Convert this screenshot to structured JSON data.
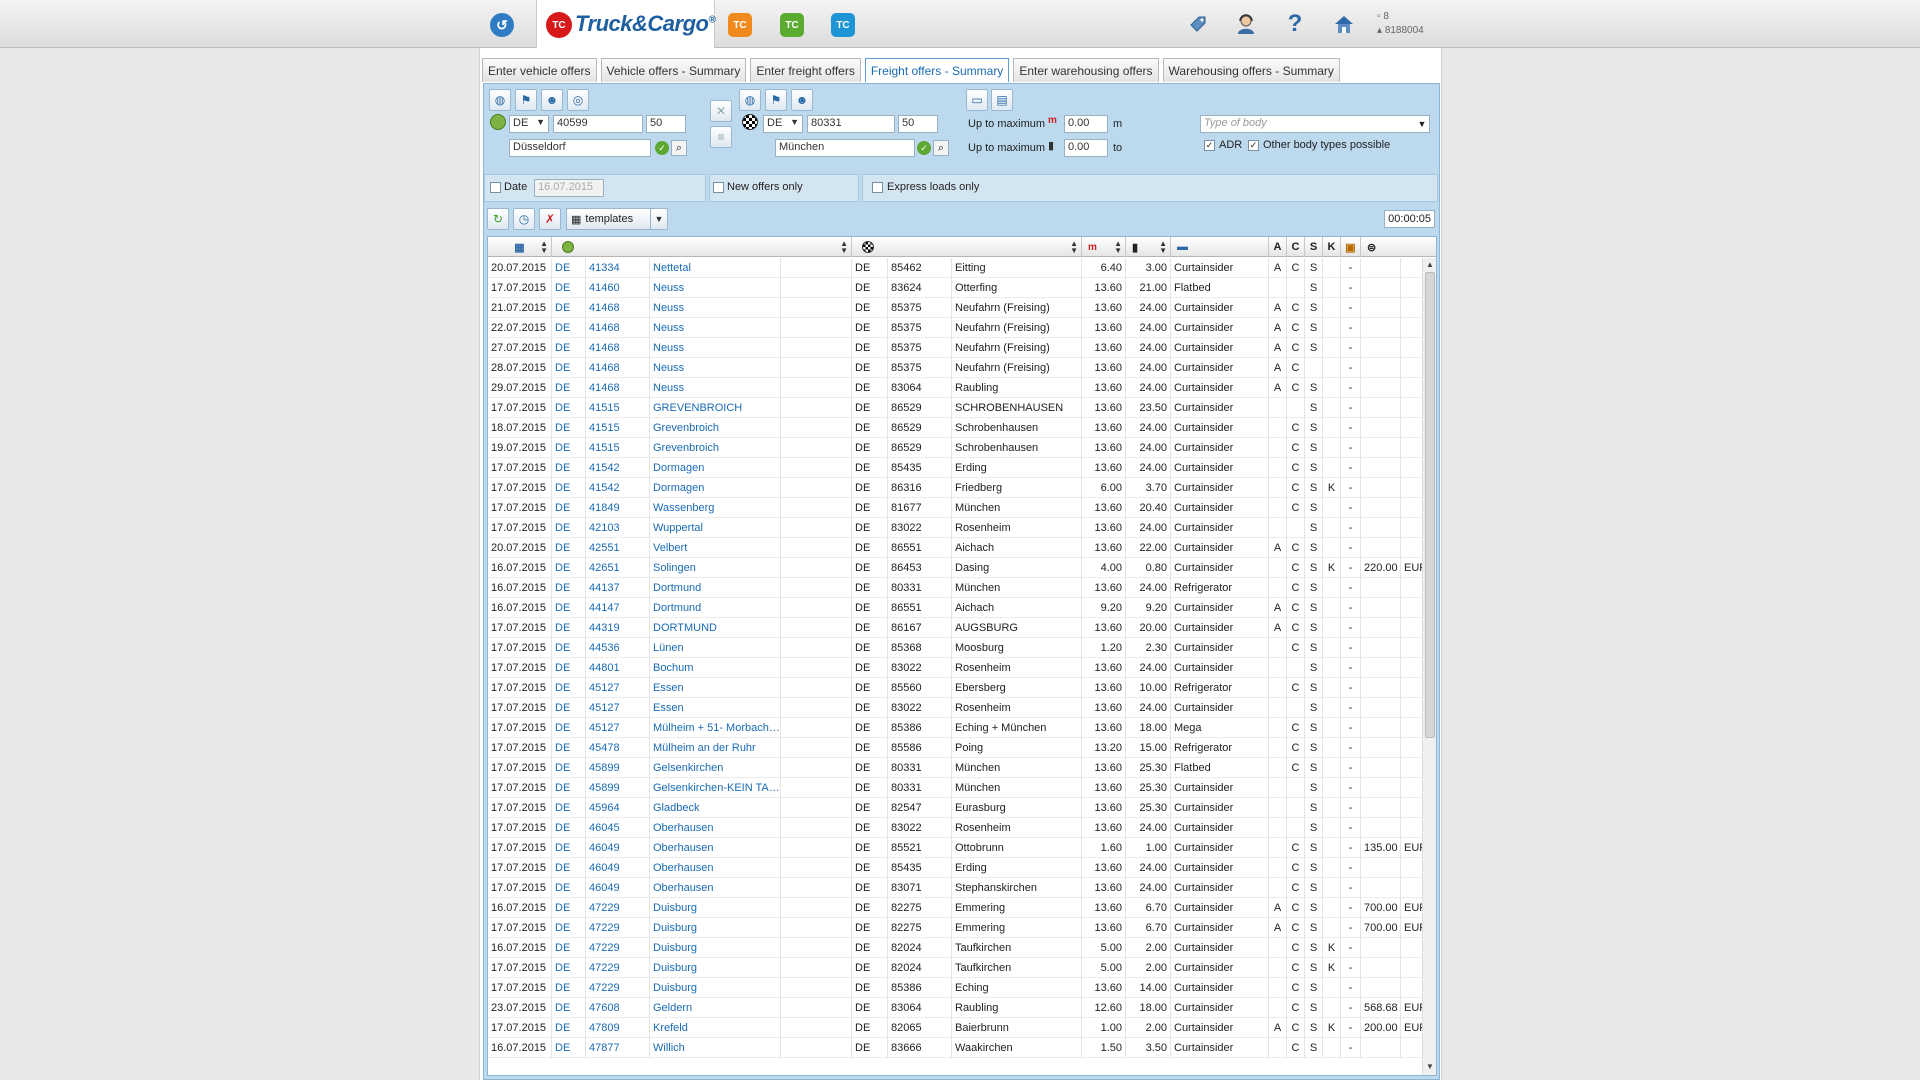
{
  "topbar": {
    "app_title_main": "Truck&Cargo",
    "app_title_reg": "®",
    "app_logo_text": "TC",
    "app_icons": [
      "TC",
      "TC",
      "TC"
    ],
    "user_count": "8",
    "user_id": "8188004",
    "icons": [
      "tag-icon",
      "support-agent-icon",
      "help-icon",
      "home-icon"
    ]
  },
  "tabs": [
    {
      "label": "Enter vehicle offers",
      "active": false
    },
    {
      "label": "Vehicle offers - Summary",
      "active": false
    },
    {
      "label": "Enter freight offers",
      "active": false
    },
    {
      "label": "Freight offers - Summary",
      "active": true
    },
    {
      "label": "Enter warehousing offers",
      "active": false
    },
    {
      "label": "Warehousing offers - Summary",
      "active": false
    }
  ],
  "search": {
    "origin": {
      "country": "DE",
      "zip": "40599",
      "radius": "50",
      "city": "Düsseldorf"
    },
    "destination": {
      "country": "DE",
      "zip": "80331",
      "radius": "50",
      "city": "München"
    },
    "max_length_label": "Up to maximum",
    "max_length_value": "0.00",
    "max_length_unit": "m",
    "max_weight_label": "Up to maximum",
    "max_weight_value": "0.00",
    "max_weight_unit": "to",
    "body_type_placeholder": "Type of body",
    "adr_label": "ADR",
    "adr_checked": true,
    "other_body_label": "Other body types possible",
    "other_body_checked": true,
    "date_label": "Date",
    "date_value": "16.07.2015",
    "date_checked": false,
    "new_offers_label": "New offers only",
    "new_offers_checked": false,
    "express_label": "Express loads only",
    "express_checked": false
  },
  "toolbar": {
    "templates_label": "templates",
    "timer": "00:00:05"
  },
  "table": {
    "flag_headers": [
      "A",
      "C",
      "S",
      "K"
    ],
    "rows": [
      {
        "date": "20.07.2015",
        "oc": "DE",
        "ozip": "41334",
        "ocity": "Nettetal",
        "dc": "DE",
        "dzip": "85462",
        "dcity": "Eitting",
        "len": "6.40",
        "wt": "3.00",
        "body": "Curtainsider",
        "a": "A",
        "c": "C",
        "s": "S",
        "k": "",
        "dash": "-",
        "price": "",
        "cur": ""
      },
      {
        "date": "17.07.2015",
        "oc": "DE",
        "ozip": "41460",
        "ocity": "Neuss",
        "dc": "DE",
        "dzip": "83624",
        "dcity": "Otterfing",
        "len": "13.60",
        "wt": "21.00",
        "body": "Flatbed",
        "a": "",
        "c": "",
        "s": "S",
        "k": "",
        "dash": "-",
        "price": "",
        "cur": ""
      },
      {
        "date": "21.07.2015",
        "oc": "DE",
        "ozip": "41468",
        "ocity": "Neuss",
        "dc": "DE",
        "dzip": "85375",
        "dcity": "Neufahrn (Freising)",
        "len": "13.60",
        "wt": "24.00",
        "body": "Curtainsider",
        "a": "A",
        "c": "C",
        "s": "S",
        "k": "",
        "dash": "-",
        "price": "",
        "cur": ""
      },
      {
        "date": "22.07.2015",
        "oc": "DE",
        "ozip": "41468",
        "ocity": "Neuss",
        "dc": "DE",
        "dzip": "85375",
        "dcity": "Neufahrn (Freising)",
        "len": "13.60",
        "wt": "24.00",
        "body": "Curtainsider",
        "a": "A",
        "c": "C",
        "s": "S",
        "k": "",
        "dash": "-",
        "price": "",
        "cur": ""
      },
      {
        "date": "27.07.2015",
        "oc": "DE",
        "ozip": "41468",
        "ocity": "Neuss",
        "dc": "DE",
        "dzip": "85375",
        "dcity": "Neufahrn (Freising)",
        "len": "13.60",
        "wt": "24.00",
        "body": "Curtainsider",
        "a": "A",
        "c": "C",
        "s": "S",
        "k": "",
        "dash": "-",
        "price": "",
        "cur": ""
      },
      {
        "date": "28.07.2015",
        "oc": "DE",
        "ozip": "41468",
        "ocity": "Neuss",
        "dc": "DE",
        "dzip": "85375",
        "dcity": "Neufahrn (Freising)",
        "len": "13.60",
        "wt": "24.00",
        "body": "Curtainsider",
        "a": "A",
        "c": "C",
        "s": "",
        "k": "",
        "dash": "-",
        "price": "",
        "cur": ""
      },
      {
        "date": "29.07.2015",
        "oc": "DE",
        "ozip": "41468",
        "ocity": "Neuss",
        "dc": "DE",
        "dzip": "83064",
        "dcity": "Raubling",
        "len": "13.60",
        "wt": "24.00",
        "body": "Curtainsider",
        "a": "A",
        "c": "C",
        "s": "S",
        "k": "",
        "dash": "-",
        "price": "",
        "cur": ""
      },
      {
        "date": "17.07.2015",
        "oc": "DE",
        "ozip": "41515",
        "ocity": "GREVENBROICH",
        "dc": "DE",
        "dzip": "86529",
        "dcity": "SCHROBENHAUSEN",
        "len": "13.60",
        "wt": "23.50",
        "body": "Curtainsider",
        "a": "",
        "c": "",
        "s": "S",
        "k": "",
        "dash": "-",
        "price": "",
        "cur": ""
      },
      {
        "date": "18.07.2015",
        "oc": "DE",
        "ozip": "41515",
        "ocity": "Grevenbroich",
        "dc": "DE",
        "dzip": "86529",
        "dcity": "Schrobenhausen",
        "len": "13.60",
        "wt": "24.00",
        "body": "Curtainsider",
        "a": "",
        "c": "C",
        "s": "S",
        "k": "",
        "dash": "-",
        "price": "",
        "cur": ""
      },
      {
        "date": "19.07.2015",
        "oc": "DE",
        "ozip": "41515",
        "ocity": "Grevenbroich",
        "dc": "DE",
        "dzip": "86529",
        "dcity": "Schrobenhausen",
        "len": "13.60",
        "wt": "24.00",
        "body": "Curtainsider",
        "a": "",
        "c": "C",
        "s": "S",
        "k": "",
        "dash": "-",
        "price": "",
        "cur": ""
      },
      {
        "date": "17.07.2015",
        "oc": "DE",
        "ozip": "41542",
        "ocity": "Dormagen",
        "dc": "DE",
        "dzip": "85435",
        "dcity": "Erding",
        "len": "13.60",
        "wt": "24.00",
        "body": "Curtainsider",
        "a": "",
        "c": "C",
        "s": "S",
        "k": "",
        "dash": "-",
        "price": "",
        "cur": ""
      },
      {
        "date": "17.07.2015",
        "oc": "DE",
        "ozip": "41542",
        "ocity": "Dormagen",
        "dc": "DE",
        "dzip": "86316",
        "dcity": "Friedberg",
        "len": "6.00",
        "wt": "3.70",
        "body": "Curtainsider",
        "a": "",
        "c": "C",
        "s": "S",
        "k": "K",
        "dash": "-",
        "price": "",
        "cur": ""
      },
      {
        "date": "17.07.2015",
        "oc": "DE",
        "ozip": "41849",
        "ocity": "Wassenberg",
        "dc": "DE",
        "dzip": "81677",
        "dcity": "München",
        "len": "13.60",
        "wt": "20.40",
        "body": "Curtainsider",
        "a": "",
        "c": "C",
        "s": "S",
        "k": "",
        "dash": "-",
        "price": "",
        "cur": ""
      },
      {
        "date": "17.07.2015",
        "oc": "DE",
        "ozip": "42103",
        "ocity": "Wuppertal",
        "dc": "DE",
        "dzip": "83022",
        "dcity": "Rosenheim",
        "len": "13.60",
        "wt": "24.00",
        "body": "Curtainsider",
        "a": "",
        "c": "",
        "s": "S",
        "k": "",
        "dash": "-",
        "price": "",
        "cur": ""
      },
      {
        "date": "20.07.2015",
        "oc": "DE",
        "ozip": "42551",
        "ocity": "Velbert",
        "dc": "DE",
        "dzip": "86551",
        "dcity": "Aichach",
        "len": "13.60",
        "wt": "22.00",
        "body": "Curtainsider",
        "a": "A",
        "c": "C",
        "s": "S",
        "k": "",
        "dash": "-",
        "price": "",
        "cur": ""
      },
      {
        "date": "16.07.2015",
        "oc": "DE",
        "ozip": "42651",
        "ocity": "Solingen",
        "dc": "DE",
        "dzip": "86453",
        "dcity": "Dasing",
        "len": "4.00",
        "wt": "0.80",
        "body": "Curtainsider",
        "a": "",
        "c": "C",
        "s": "S",
        "k": "K",
        "dash": "-",
        "price": "220.00",
        "cur": "EUR"
      },
      {
        "date": "16.07.2015",
        "oc": "DE",
        "ozip": "44137",
        "ocity": "Dortmund",
        "dc": "DE",
        "dzip": "80331",
        "dcity": "München",
        "len": "13.60",
        "wt": "24.00",
        "body": "Refrigerator",
        "a": "",
        "c": "C",
        "s": "S",
        "k": "",
        "dash": "-",
        "price": "",
        "cur": ""
      },
      {
        "date": "16.07.2015",
        "oc": "DE",
        "ozip": "44147",
        "ocity": "Dortmund",
        "dc": "DE",
        "dzip": "86551",
        "dcity": "Aichach",
        "len": "9.20",
        "wt": "9.20",
        "body": "Curtainsider",
        "a": "A",
        "c": "C",
        "s": "S",
        "k": "",
        "dash": "-",
        "price": "",
        "cur": ""
      },
      {
        "date": "17.07.2015",
        "oc": "DE",
        "ozip": "44319",
        "ocity": "DORTMUND",
        "dc": "DE",
        "dzip": "86167",
        "dcity": "AUGSBURG",
        "len": "13.60",
        "wt": "20.00",
        "body": "Curtainsider",
        "a": "A",
        "c": "C",
        "s": "S",
        "k": "",
        "dash": "-",
        "price": "",
        "cur": ""
      },
      {
        "date": "17.07.2015",
        "oc": "DE",
        "ozip": "44536",
        "ocity": "Lünen",
        "dc": "DE",
        "dzip": "85368",
        "dcity": "Moosburg",
        "len": "1.20",
        "wt": "2.30",
        "body": "Curtainsider",
        "a": "",
        "c": "C",
        "s": "S",
        "k": "",
        "dash": "-",
        "price": "",
        "cur": ""
      },
      {
        "date": "17.07.2015",
        "oc": "DE",
        "ozip": "44801",
        "ocity": "Bochum",
        "dc": "DE",
        "dzip": "83022",
        "dcity": "Rosenheim",
        "len": "13.60",
        "wt": "24.00",
        "body": "Curtainsider",
        "a": "",
        "c": "",
        "s": "S",
        "k": "",
        "dash": "-",
        "price": "",
        "cur": ""
      },
      {
        "date": "17.07.2015",
        "oc": "DE",
        "ozip": "45127",
        "ocity": "Essen",
        "dc": "DE",
        "dzip": "85560",
        "dcity": "Ebersberg",
        "len": "13.60",
        "wt": "10.00",
        "body": "Refrigerator",
        "a": "",
        "c": "C",
        "s": "S",
        "k": "",
        "dash": "-",
        "price": "",
        "cur": ""
      },
      {
        "date": "17.07.2015",
        "oc": "DE",
        "ozip": "45127",
        "ocity": "Essen",
        "dc": "DE",
        "dzip": "83022",
        "dcity": "Rosenheim",
        "len": "13.60",
        "wt": "24.00",
        "body": "Curtainsider",
        "a": "",
        "c": "",
        "s": "S",
        "k": "",
        "dash": "-",
        "price": "",
        "cur": ""
      },
      {
        "date": "17.07.2015",
        "oc": "DE",
        "ozip": "45127",
        "ocity": "Mülheim + 51- Morbach…",
        "dc": "DE",
        "dzip": "85386",
        "dcity": "Eching + München",
        "len": "13.60",
        "wt": "18.00",
        "body": "Mega",
        "a": "",
        "c": "C",
        "s": "S",
        "k": "",
        "dash": "-",
        "price": "",
        "cur": ""
      },
      {
        "date": "17.07.2015",
        "oc": "DE",
        "ozip": "45478",
        "ocity": "Mülheim an der Ruhr",
        "dc": "DE",
        "dzip": "85586",
        "dcity": "Poing",
        "len": "13.20",
        "wt": "15.00",
        "body": "Refrigerator",
        "a": "",
        "c": "C",
        "s": "S",
        "k": "",
        "dash": "-",
        "price": "",
        "cur": ""
      },
      {
        "date": "17.07.2015",
        "oc": "DE",
        "ozip": "45899",
        "ocity": "Gelsenkirchen",
        "dc": "DE",
        "dzip": "80331",
        "dcity": "München",
        "len": "13.60",
        "wt": "25.30",
        "body": "Flatbed",
        "a": "",
        "c": "C",
        "s": "S",
        "k": "",
        "dash": "-",
        "price": "",
        "cur": ""
      },
      {
        "date": "17.07.2015",
        "oc": "DE",
        "ozip": "45899",
        "ocity": "Gelsenkirchen-KEIN TA…",
        "dc": "DE",
        "dzip": "80331",
        "dcity": "München",
        "len": "13.60",
        "wt": "25.30",
        "body": "Curtainsider",
        "a": "",
        "c": "",
        "s": "S",
        "k": "",
        "dash": "-",
        "price": "",
        "cur": ""
      },
      {
        "date": "17.07.2015",
        "oc": "DE",
        "ozip": "45964",
        "ocity": "Gladbeck",
        "dc": "DE",
        "dzip": "82547",
        "dcity": "Eurasburg",
        "len": "13.60",
        "wt": "25.30",
        "body": "Curtainsider",
        "a": "",
        "c": "",
        "s": "S",
        "k": "",
        "dash": "-",
        "price": "",
        "cur": ""
      },
      {
        "date": "17.07.2015",
        "oc": "DE",
        "ozip": "46045",
        "ocity": "Oberhausen",
        "dc": "DE",
        "dzip": "83022",
        "dcity": "Rosenheim",
        "len": "13.60",
        "wt": "24.00",
        "body": "Curtainsider",
        "a": "",
        "c": "",
        "s": "S",
        "k": "",
        "dash": "-",
        "price": "",
        "cur": ""
      },
      {
        "date": "17.07.2015",
        "oc": "DE",
        "ozip": "46049",
        "ocity": "Oberhausen",
        "dc": "DE",
        "dzip": "85521",
        "dcity": "Ottobrunn",
        "len": "1.60",
        "wt": "1.00",
        "body": "Curtainsider",
        "a": "",
        "c": "C",
        "s": "S",
        "k": "",
        "dash": "-",
        "price": "135.00",
        "cur": "EUR"
      },
      {
        "date": "17.07.2015",
        "oc": "DE",
        "ozip": "46049",
        "ocity": "Oberhausen",
        "dc": "DE",
        "dzip": "85435",
        "dcity": "Erding",
        "len": "13.60",
        "wt": "24.00",
        "body": "Curtainsider",
        "a": "",
        "c": "C",
        "s": "S",
        "k": "",
        "dash": "-",
        "price": "",
        "cur": ""
      },
      {
        "date": "17.07.2015",
        "oc": "DE",
        "ozip": "46049",
        "ocity": "Oberhausen",
        "dc": "DE",
        "dzip": "83071",
        "dcity": "Stephanskirchen",
        "len": "13.60",
        "wt": "24.00",
        "body": "Curtainsider",
        "a": "",
        "c": "C",
        "s": "S",
        "k": "",
        "dash": "-",
        "price": "",
        "cur": ""
      },
      {
        "date": "16.07.2015",
        "oc": "DE",
        "ozip": "47229",
        "ocity": "Duisburg",
        "dc": "DE",
        "dzip": "82275",
        "dcity": "Emmering",
        "len": "13.60",
        "wt": "6.70",
        "body": "Curtainsider",
        "a": "A",
        "c": "C",
        "s": "S",
        "k": "",
        "dash": "-",
        "price": "700.00",
        "cur": "EUR"
      },
      {
        "date": "17.07.2015",
        "oc": "DE",
        "ozip": "47229",
        "ocity": "Duisburg",
        "dc": "DE",
        "dzip": "82275",
        "dcity": "Emmering",
        "len": "13.60",
        "wt": "6.70",
        "body": "Curtainsider",
        "a": "A",
        "c": "C",
        "s": "S",
        "k": "",
        "dash": "-",
        "price": "700.00",
        "cur": "EUR"
      },
      {
        "date": "16.07.2015",
        "oc": "DE",
        "ozip": "47229",
        "ocity": "Duisburg",
        "dc": "DE",
        "dzip": "82024",
        "dcity": "Taufkirchen",
        "len": "5.00",
        "wt": "2.00",
        "body": "Curtainsider",
        "a": "",
        "c": "C",
        "s": "S",
        "k": "K",
        "dash": "-",
        "price": "",
        "cur": ""
      },
      {
        "date": "17.07.2015",
        "oc": "DE",
        "ozip": "47229",
        "ocity": "Duisburg",
        "dc": "DE",
        "dzip": "82024",
        "dcity": "Taufkirchen",
        "len": "5.00",
        "wt": "2.00",
        "body": "Curtainsider",
        "a": "",
        "c": "C",
        "s": "S",
        "k": "K",
        "dash": "-",
        "price": "",
        "cur": ""
      },
      {
        "date": "17.07.2015",
        "oc": "DE",
        "ozip": "47229",
        "ocity": "Duisburg",
        "dc": "DE",
        "dzip": "85386",
        "dcity": "Eching",
        "len": "13.60",
        "wt": "14.00",
        "body": "Curtainsider",
        "a": "",
        "c": "C",
        "s": "S",
        "k": "",
        "dash": "-",
        "price": "",
        "cur": ""
      },
      {
        "date": "23.07.2015",
        "oc": "DE",
        "ozip": "47608",
        "ocity": "Geldern",
        "dc": "DE",
        "dzip": "83064",
        "dcity": "Raubling",
        "len": "12.60",
        "wt": "18.00",
        "body": "Curtainsider",
        "a": "",
        "c": "C",
        "s": "S",
        "k": "",
        "dash": "-",
        "price": "568.68",
        "cur": "EUR"
      },
      {
        "date": "17.07.2015",
        "oc": "DE",
        "ozip": "47809",
        "ocity": "Krefeld",
        "dc": "DE",
        "dzip": "82065",
        "dcity": "Baierbrunn",
        "len": "1.00",
        "wt": "2.00",
        "body": "Curtainsider",
        "a": "A",
        "c": "C",
        "s": "S",
        "k": "K",
        "dash": "-",
        "price": "200.00",
        "cur": "EUR"
      },
      {
        "date": "16.07.2015",
        "oc": "DE",
        "ozip": "47877",
        "ocity": "Willich",
        "dc": "DE",
        "dzip": "83666",
        "dcity": "Waakirchen",
        "len": "1.50",
        "wt": "3.50",
        "body": "Curtainsider",
        "a": "",
        "c": "C",
        "s": "S",
        "k": "",
        "dash": "-",
        "price": "",
        "cur": ""
      }
    ]
  }
}
